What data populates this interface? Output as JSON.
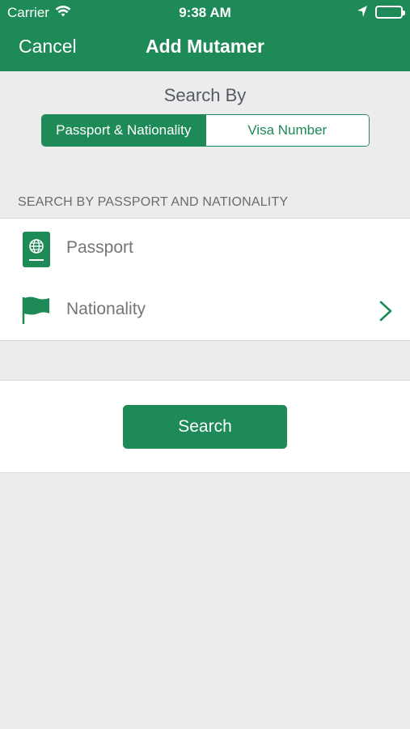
{
  "status_bar": {
    "carrier": "Carrier",
    "time": "9:38 AM",
    "icons": [
      "wifi-icon",
      "location-arrow-icon",
      "battery-icon"
    ]
  },
  "nav": {
    "cancel_label": "Cancel",
    "title": "Add Mutamer"
  },
  "search_by": {
    "heading": "Search By",
    "segments": [
      "Passport & Nationality",
      "Visa Number"
    ],
    "selected": "Passport & Nationality"
  },
  "section": {
    "header": "SEARCH BY PASSPORT AND NATIONALITY"
  },
  "form": {
    "passport": {
      "placeholder": "Passport",
      "value": "",
      "icon": "passport-icon"
    },
    "nationality": {
      "placeholder": "Nationality",
      "value": "",
      "icon": "flag-icon",
      "accessory": "chevron-right-icon"
    }
  },
  "actions": {
    "search_label": "Search"
  },
  "colors": {
    "brand": "#1e8a57",
    "background": "#ececec",
    "placeholder": "#c3c3c7"
  }
}
